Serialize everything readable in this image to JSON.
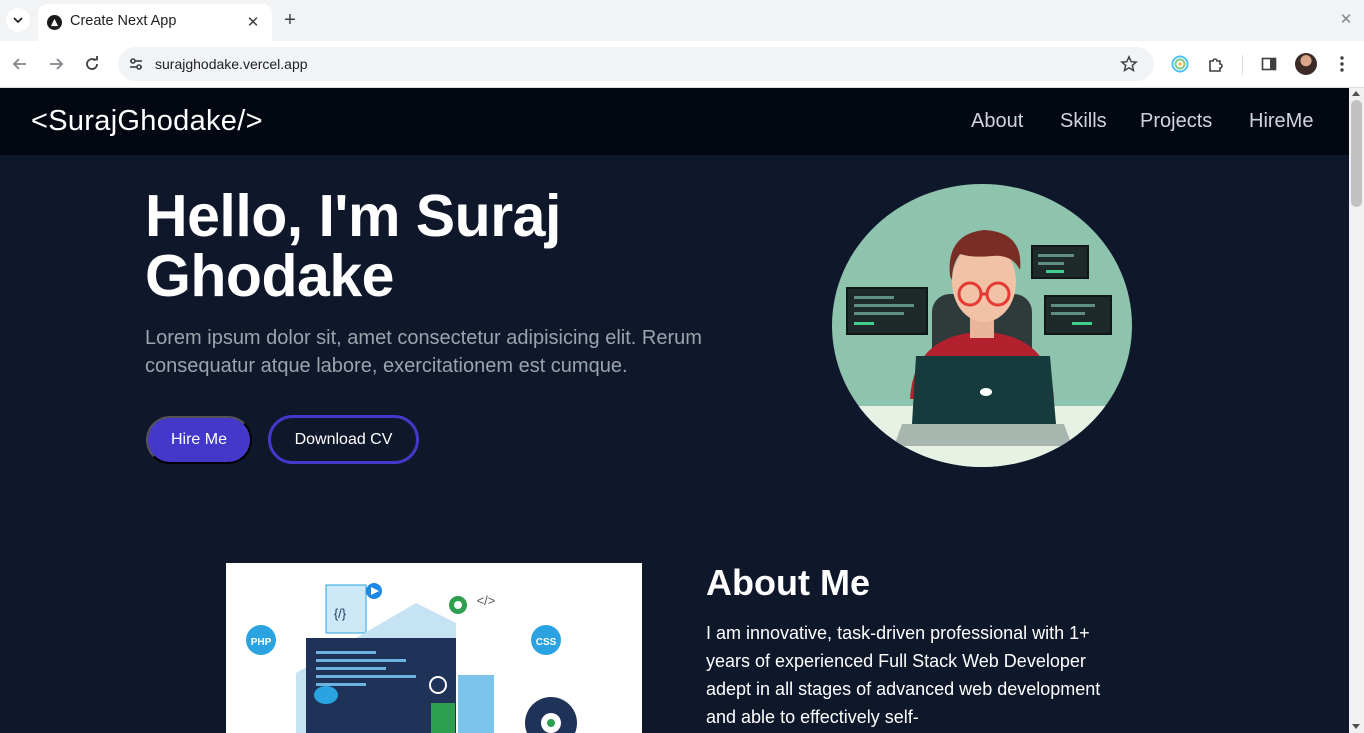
{
  "browser": {
    "tab_title": "Create Next App",
    "url": "surajghodake.vercel.app"
  },
  "site": {
    "brand": "<SurajGhodake/>",
    "nav": [
      "About",
      "Skills",
      "Projects",
      "HireMe"
    ]
  },
  "hero": {
    "title": "Hello, I'm Suraj Ghodake",
    "subtitle": "Lorem ipsum dolor sit, amet consectetur adipisicing elit. Rerum consequatur atque labore, exercitationem est cumque.",
    "hire_label": "Hire Me",
    "cv_label": "Download CV"
  },
  "about": {
    "title": "About Me",
    "text": "I am innovative, task-driven professional with 1+ years of experienced Full Stack Web Developer adept in all stages of advanced web development and able to effectively self-",
    "badges": [
      "PHP",
      "CSS",
      "{/}",
      "</>"
    ]
  },
  "colors": {
    "accent": "#4338ca",
    "page_bg": "#0f172a",
    "nav_bg": "#030712"
  }
}
